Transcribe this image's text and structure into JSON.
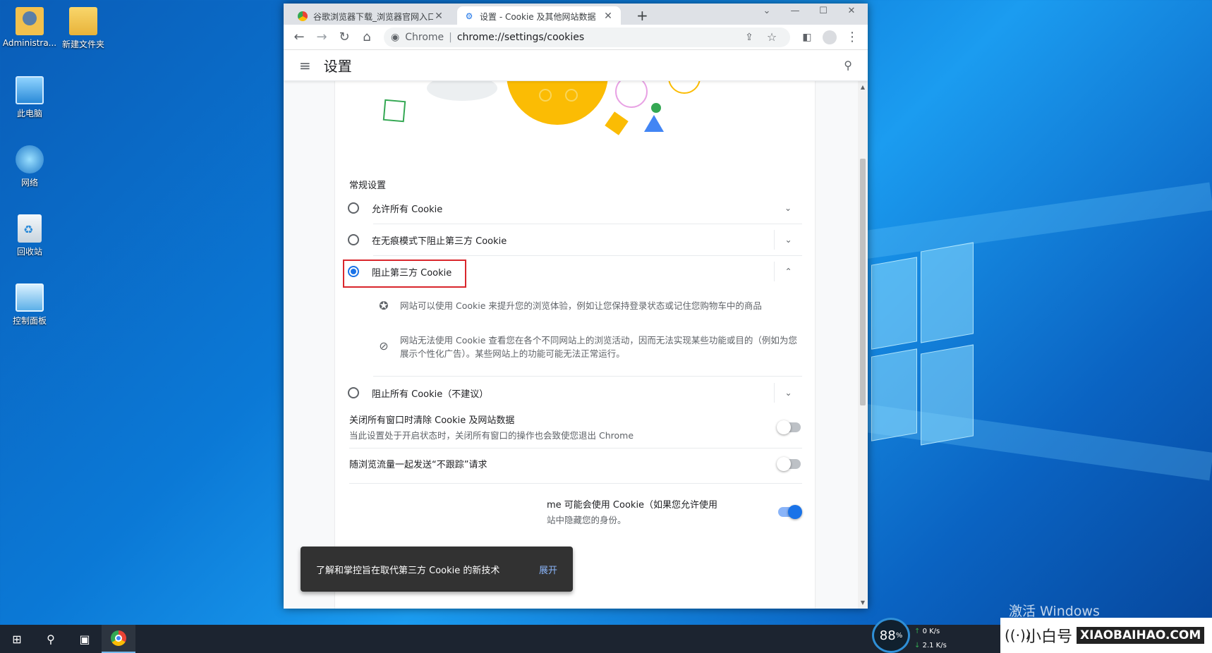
{
  "desktop": {
    "icons": [
      {
        "label": "Administra...",
        "icon": "user-folder-icon"
      },
      {
        "label": "新建文件夹",
        "icon": "folder-icon"
      },
      {
        "label": "此电脑",
        "icon": "computer-icon"
      },
      {
        "label": "网络",
        "icon": "network-icon"
      },
      {
        "label": "回收站",
        "icon": "recycle-bin-icon"
      },
      {
        "label": "控制面板",
        "icon": "control-panel-icon"
      }
    ],
    "activate_text": "激活 Windows"
  },
  "browser": {
    "tabs": [
      {
        "title": "谷歌浏览器下载_浏览器官网入口",
        "favicon": "chrome-icon",
        "active": false
      },
      {
        "title": "设置 - Cookie 及其他网站数据",
        "favicon": "gear-icon",
        "active": true
      }
    ],
    "new_tab": "+",
    "window_controls": [
      "⌄",
      "—",
      "☐",
      "✕"
    ],
    "omnibox": {
      "site": "Chrome",
      "url": "chrome://settings/cookies"
    },
    "settings_title": "设置",
    "section_title": "常规设置",
    "options": [
      {
        "label": "允许所有 Cookie",
        "checked": false
      },
      {
        "label": "在无痕模式下阻止第三方 Cookie",
        "checked": false
      },
      {
        "label": "阻止第三方 Cookie",
        "checked": true
      },
      {
        "label": "阻止所有 Cookie（不建议）",
        "checked": false
      }
    ],
    "details": [
      {
        "icon": "cookie-icon",
        "text": "网站可以使用 Cookie 来提升您的浏览体验，例如让您保持登录状态或记住您购物车中的商品"
      },
      {
        "icon": "block-icon",
        "text": "网站无法使用 Cookie 查看您在各个不同网站上的浏览活动，因而无法实现某些功能或目的（例如为您展示个性化广告）。某些网站上的功能可能无法正常运行。"
      }
    ],
    "toggles": [
      {
        "main": "关闭所有窗口时清除 Cookie 及网站数据",
        "sub": "当此设置处于开启状态时，关闭所有窗口的操作也会致使您退出 Chrome",
        "on": false
      },
      {
        "main": "随浏览流量一起发送“不跟踪”请求",
        "sub": "",
        "on": false
      },
      {
        "main": "me 可能会使用 Cookie（如果您允许使用",
        "sub": "站中隐藏您的身份。",
        "on": true
      }
    ],
    "snackbar": {
      "message": "了解和掌控旨在取代第三方 Cookie 的新技术",
      "action": "展开"
    }
  },
  "taskbar": {
    "cpu_percent": "88",
    "cpu_unit": "%",
    "upload": "0 K/s",
    "download": "2.1 K/s",
    "brand_name": "小白号",
    "brand_url": "XIAOBAIHAO.COM"
  },
  "colors": {
    "accent": "#1a73e8",
    "highlight_box": "#d9262c",
    "desktop": "#0b79d6"
  }
}
